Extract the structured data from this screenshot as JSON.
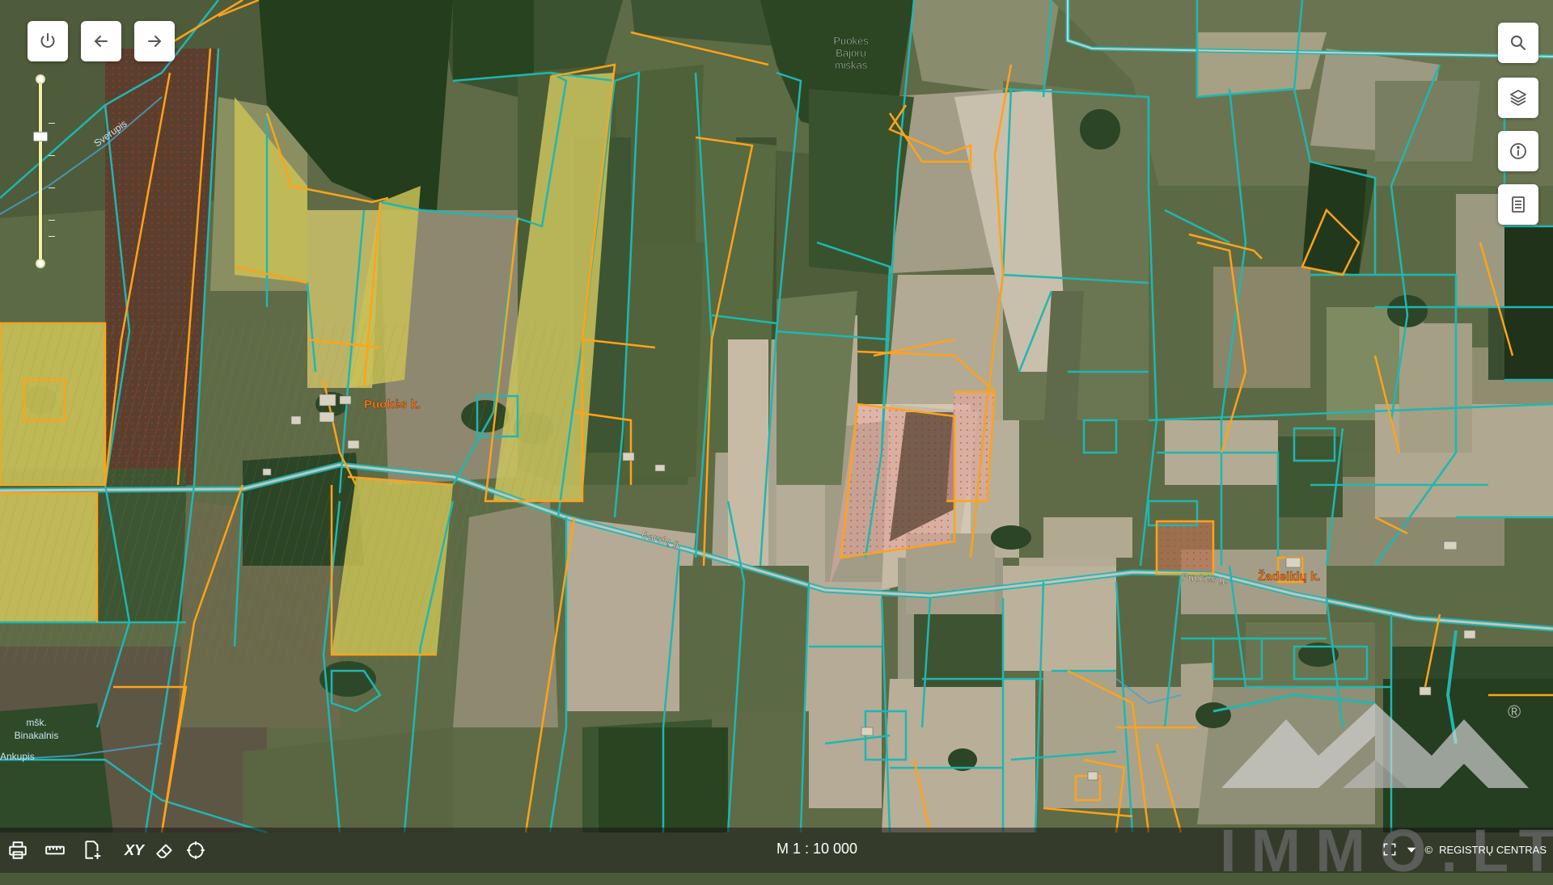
{
  "map": {
    "labels": {
      "forest_upper": "Puokės",
      "forest_middle": "Bajorų",
      "forest_lower": "miškas",
      "village_1": "Puokės k.",
      "village_2": "Žadeikių k.",
      "road_1": "Barsių g.",
      "road_2": "Puokės g.",
      "stream_top": "Sverupis",
      "stream_left": "Ankupis",
      "hill_upper": "mšk.",
      "hill_lower": "Binakalnis"
    },
    "colors": {
      "parcel_border": "#1fb7b0",
      "claim_border": "#ffa31a",
      "crop_yellow": "#c9c156",
      "highlight_pink": "#e8a7a0",
      "label_orange": "#ff7a1a"
    }
  },
  "controls": {
    "left": [
      {
        "name": "power-button",
        "icon": "power-icon"
      },
      {
        "name": "back-button",
        "icon": "arrow-left-icon"
      },
      {
        "name": "forward-button",
        "icon": "arrow-right-icon"
      }
    ],
    "right": [
      {
        "name": "search-button",
        "icon": "search-icon"
      },
      {
        "name": "layers-button",
        "icon": "layers-icon"
      },
      {
        "name": "info-button",
        "icon": "info-icon"
      },
      {
        "name": "legend-button",
        "icon": "document-icon"
      }
    ],
    "zoom_level": 0.7
  },
  "bottom_bar": {
    "xy_label": "XY",
    "scale": "M 1 : 10 000",
    "credit": "REGISTRŲ CENTRAS",
    "icons": [
      "print-icon",
      "ruler-icon",
      "add-document-icon",
      "xy-icon",
      "eraser-icon",
      "crosshair-icon"
    ]
  },
  "watermark": {
    "text": "IMMO.LT",
    "registered": "®"
  }
}
